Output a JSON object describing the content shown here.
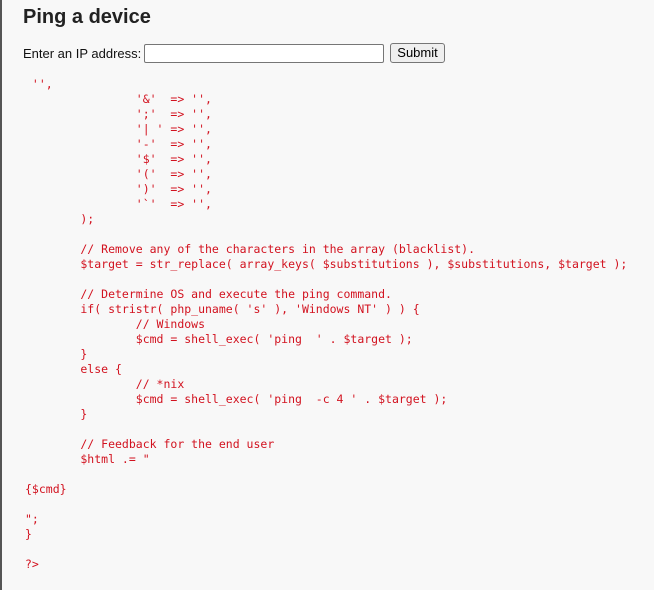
{
  "page": {
    "heading": "Ping a device"
  },
  "form": {
    "ip_label": "Enter an IP address:",
    "ip_value": "",
    "ip_placeholder": "",
    "submit_label": "Submit"
  },
  "output": {
    "code_lines": [
      " '',",
      "                '&'  => '',",
      "                ';'  => '',",
      "                '| ' => '',",
      "                '-'  => '',",
      "                '$'  => '',",
      "                '('  => '',",
      "                ')'  => '',",
      "                '`'  => '',",
      "        );",
      "",
      "        // Remove any of the characters in the array (blacklist).",
      "        $target = str_replace( array_keys( $substitutions ), $substitutions, $target );",
      "",
      "        // Determine OS and execute the ping command.",
      "        if( stristr( php_uname( 's' ), 'Windows NT' ) ) {",
      "                // Windows",
      "                $cmd = shell_exec( 'ping  ' . $target );",
      "        }",
      "        else {",
      "                // *nix",
      "                $cmd = shell_exec( 'ping  -c 4 ' . $target );",
      "        }",
      "",
      "        // Feedback for the end user",
      "        $html .= \"",
      "",
      "{$cmd}",
      "",
      "\";",
      "}",
      "",
      "?>"
    ]
  }
}
